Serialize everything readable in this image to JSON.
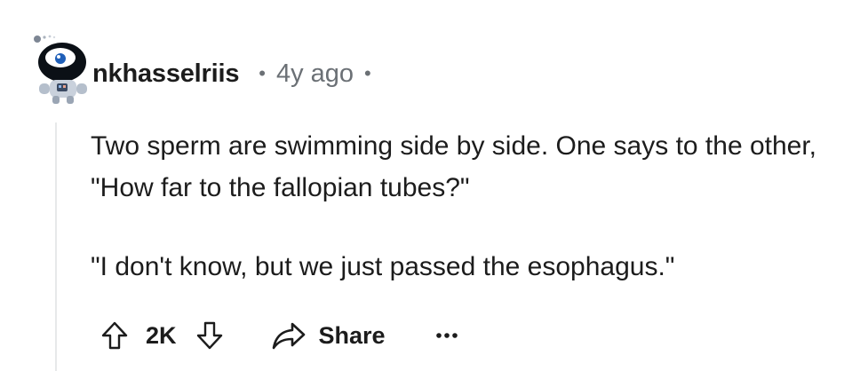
{
  "comment": {
    "author": "nkhasselriis",
    "separator": "•",
    "timestamp": "4y ago",
    "paragraphs": [
      "Two sperm are swimming side by side. One says to the other, \"How far to the fallopian tubes?\"",
      "\"I don't know, but we just passed the esophagus.\""
    ]
  },
  "actions": {
    "upvote_icon": "arrow-up-outline",
    "score": "2K",
    "downvote_icon": "arrow-down-outline",
    "share_icon": "share-arrow",
    "share_label": "Share",
    "more_icon": "ellipsis-horizontal"
  },
  "colors": {
    "text_primary": "#1c1c1c",
    "text_secondary": "#6b7075",
    "thread_line": "#e7e9ea",
    "avatar_head": "#0b1016",
    "avatar_body": "#c9d1dc"
  }
}
